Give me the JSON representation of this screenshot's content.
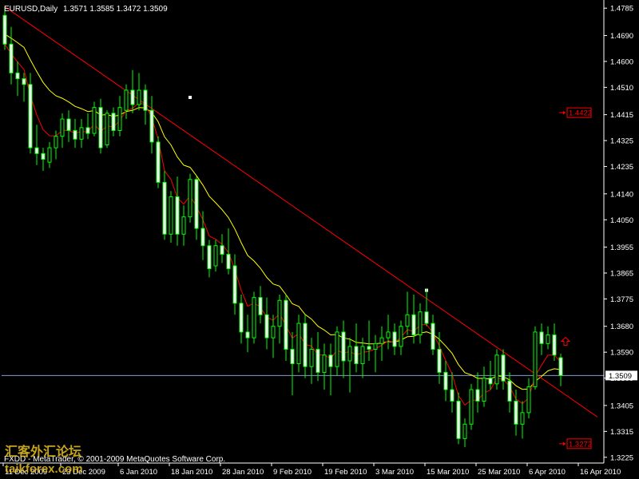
{
  "header": {
    "symbol_timeframe": "EURUSD,Daily",
    "ohlc": "1.3571 1.3585 1.3472 1.3509"
  },
  "footer": {
    "copyright": "FXDD - MetaTrader, © 2001-2009 MetaQuotes Software Corp."
  },
  "watermark": {
    "text_cn": "汇客外汇论坛",
    "text_en": "taikforex.com"
  },
  "colors": {
    "background": "#000000",
    "axis": "#ffffff",
    "bull": "#00ff00",
    "bear": "#ffffff",
    "wick": "#00ff00",
    "ma_fast": "#ff0000",
    "ma_slow": "#ffff00",
    "trendline": "#ff0000",
    "price_line": "#7f9fcf",
    "label_bg": "#cc0000"
  },
  "chart_data": {
    "type": "candlestick",
    "y_ticks": [
      "1.4785",
      "1.4690",
      "1.4600",
      "1.4510",
      "1.4415",
      "1.4325",
      "1.4235",
      "1.4140",
      "1.4050",
      "1.3955",
      "1.3865",
      "1.3775",
      "1.3680",
      "1.3590",
      "1.3500",
      "1.3405",
      "1.3315",
      "1.3225"
    ],
    "x_ticks": [
      "11 Dec 2009",
      "23 Dec 2009",
      "6 Jan 2010",
      "18 Jan 2010",
      "28 Jan 2010",
      "9 Feb 2010",
      "19 Feb 2010",
      "3 Mar 2010",
      "15 Mar 2010",
      "25 Mar 2010",
      "6 Apr 2010",
      "16 Apr 2010"
    ],
    "ylim": [
      1.3205,
      1.4805
    ],
    "current_price": "1.3509",
    "level_labels": [
      {
        "value": "1.4422",
        "price": 1.4422
      },
      {
        "value": "1.3272",
        "price": 1.3272
      }
    ],
    "trendline": {
      "from": [
        0,
        1.479
      ],
      "to": [
        92,
        1.3365
      ]
    },
    "trend_markers": [
      [
        29,
        1.4475
      ],
      [
        66,
        1.3805
      ]
    ],
    "up_arrow": [
      89,
      1.3625
    ],
    "candles": [
      [
        1.476,
        1.479,
        1.464,
        1.466
      ],
      [
        1.466,
        1.472,
        1.452,
        1.456
      ],
      [
        1.456,
        1.46,
        1.448,
        1.454
      ],
      [
        1.454,
        1.456,
        1.446,
        1.452
      ],
      [
        1.452,
        1.456,
        1.428,
        1.43
      ],
      [
        1.43,
        1.438,
        1.424,
        1.428
      ],
      [
        1.428,
        1.43,
        1.422,
        1.426
      ],
      [
        1.425,
        1.432,
        1.423,
        1.43
      ],
      [
        1.43,
        1.436,
        1.426,
        1.434
      ],
      [
        1.434,
        1.442,
        1.43,
        1.44
      ],
      [
        1.44,
        1.443,
        1.432,
        1.436
      ],
      [
        1.436,
        1.44,
        1.43,
        1.433
      ],
      [
        1.433,
        1.44,
        1.43,
        1.437
      ],
      [
        1.437,
        1.442,
        1.433,
        1.435
      ],
      [
        1.435,
        1.446,
        1.434,
        1.444
      ],
      [
        1.444,
        1.447,
        1.428,
        1.43
      ],
      [
        1.431,
        1.443,
        1.43,
        1.442
      ],
      [
        1.442,
        1.444,
        1.434,
        1.436
      ],
      [
        1.436,
        1.448,
        1.434,
        1.444
      ],
      [
        1.443,
        1.452,
        1.44,
        1.45
      ],
      [
        1.45,
        1.457,
        1.442,
        1.445
      ],
      [
        1.445,
        1.456,
        1.443,
        1.45
      ],
      [
        1.45,
        1.452,
        1.438,
        1.443
      ],
      [
        1.443,
        1.448,
        1.428,
        1.432
      ],
      [
        1.432,
        1.434,
        1.416,
        1.418
      ],
      [
        1.418,
        1.422,
        1.398,
        1.4
      ],
      [
        1.4,
        1.415,
        1.397,
        1.413
      ],
      [
        1.413,
        1.42,
        1.396,
        1.4
      ],
      [
        1.4,
        1.41,
        1.396,
        1.406
      ],
      [
        1.406,
        1.421,
        1.404,
        1.419
      ],
      [
        1.419,
        1.42,
        1.398,
        1.402
      ],
      [
        1.402,
        1.408,
        1.391,
        1.396
      ],
      [
        1.396,
        1.398,
        1.385,
        1.388
      ],
      [
        1.389,
        1.398,
        1.387,
        1.396
      ],
      [
        1.396,
        1.4,
        1.39,
        1.393
      ],
      [
        1.393,
        1.402,
        1.386,
        1.388
      ],
      [
        1.389,
        1.393,
        1.372,
        1.376
      ],
      [
        1.376,
        1.379,
        1.362,
        1.366
      ],
      [
        1.366,
        1.372,
        1.359,
        1.364
      ],
      [
        1.364,
        1.38,
        1.362,
        1.378
      ],
      [
        1.378,
        1.382,
        1.369,
        1.372
      ],
      [
        1.372,
        1.378,
        1.36,
        1.364
      ],
      [
        1.364,
        1.372,
        1.357,
        1.368
      ],
      [
        1.368,
        1.379,
        1.362,
        1.377
      ],
      [
        1.377,
        1.379,
        1.356,
        1.36
      ],
      [
        1.36,
        1.366,
        1.344,
        1.355
      ],
      [
        1.355,
        1.372,
        1.352,
        1.369
      ],
      [
        1.369,
        1.372,
        1.35,
        1.354
      ],
      [
        1.354,
        1.364,
        1.348,
        1.36
      ],
      [
        1.36,
        1.366,
        1.349,
        1.352
      ],
      [
        1.352,
        1.362,
        1.346,
        1.358
      ],
      [
        1.358,
        1.362,
        1.344,
        1.354
      ],
      [
        1.354,
        1.368,
        1.351,
        1.366
      ],
      [
        1.366,
        1.37,
        1.35,
        1.356
      ],
      [
        1.356,
        1.364,
        1.345,
        1.361
      ],
      [
        1.361,
        1.369,
        1.352,
        1.355
      ],
      [
        1.355,
        1.364,
        1.35,
        1.361
      ],
      [
        1.361,
        1.37,
        1.356,
        1.36
      ],
      [
        1.36,
        1.365,
        1.352,
        1.362
      ],
      [
        1.362,
        1.368,
        1.356,
        1.364
      ],
      [
        1.364,
        1.372,
        1.36,
        1.366
      ],
      [
        1.366,
        1.369,
        1.358,
        1.361
      ],
      [
        1.361,
        1.37,
        1.358,
        1.368
      ],
      [
        1.368,
        1.38,
        1.365,
        1.372
      ],
      [
        1.372,
        1.379,
        1.362,
        1.365
      ],
      [
        1.365,
        1.376,
        1.362,
        1.373
      ],
      [
        1.373,
        1.381,
        1.368,
        1.369
      ],
      [
        1.369,
        1.372,
        1.358,
        1.36
      ],
      [
        1.36,
        1.366,
        1.348,
        1.352
      ],
      [
        1.352,
        1.356,
        1.342,
        1.346
      ],
      [
        1.346,
        1.352,
        1.338,
        1.342
      ],
      [
        1.342,
        1.345,
        1.327,
        1.329
      ],
      [
        1.329,
        1.336,
        1.326,
        1.334
      ],
      [
        1.334,
        1.348,
        1.332,
        1.346
      ],
      [
        1.346,
        1.352,
        1.338,
        1.342
      ],
      [
        1.342,
        1.354,
        1.34,
        1.35
      ],
      [
        1.35,
        1.356,
        1.346,
        1.348
      ],
      [
        1.348,
        1.36,
        1.346,
        1.358
      ],
      [
        1.358,
        1.36,
        1.346,
        1.349
      ],
      [
        1.349,
        1.352,
        1.338,
        1.342
      ],
      [
        1.342,
        1.346,
        1.33,
        1.334
      ],
      [
        1.334,
        1.342,
        1.329,
        1.338
      ],
      [
        1.338,
        1.35,
        1.336,
        1.347
      ],
      [
        1.347,
        1.368,
        1.346,
        1.366
      ],
      [
        1.366,
        1.369,
        1.358,
        1.362
      ],
      [
        1.362,
        1.368,
        1.36,
        1.365
      ],
      [
        1.365,
        1.369,
        1.356,
        1.358
      ],
      [
        1.3571,
        1.3585,
        1.3472,
        1.3509
      ]
    ]
  }
}
